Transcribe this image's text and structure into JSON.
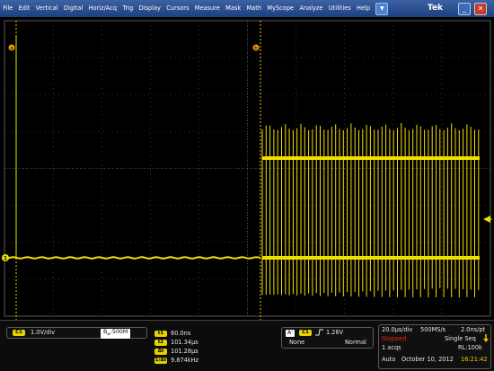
{
  "menu": {
    "items": [
      "File",
      "Edit",
      "Vertical",
      "Digital",
      "Horiz/Acq",
      "Trig",
      "Display",
      "Cursors",
      "Measure",
      "Mask",
      "Math",
      "MyScope",
      "Analyze",
      "Utilities",
      "Help"
    ],
    "dropdown_icon": "triangle-down-icon",
    "brand": "Tek",
    "minimize_glyph": "_",
    "close_glyph": "✕"
  },
  "display": {
    "trace_color": "#f0e000",
    "grid_color": "#5a5a5a",
    "cursor_a_label": "a",
    "cursor_b_label": "b",
    "channel_marker": "1"
  },
  "channel": {
    "badge": "C1",
    "scale": "1.0V/div",
    "bandwidth_prefix": "B",
    "bandwidth_sub": "w",
    "bandwidth": ":500M"
  },
  "cursors": {
    "t1_label": "t1",
    "t1": "60.0ns",
    "t2_label": "t2",
    "t2": "101.34μs",
    "dt_label": "Δt",
    "dt": "101.28μs",
    "inv_label": "1/Δt",
    "inv": "9.874kHz"
  },
  "trigger": {
    "mode_badge": "A'",
    "source_badge": "C1",
    "slope_icon": "rising-edge-icon",
    "level": "1.26V",
    "coupling": "None",
    "type": "Normal"
  },
  "timebase": {
    "scale": "20.0μs/div",
    "sample_rate": "500MS/s",
    "resolution": "2.0ns/pt",
    "state": "Stopped",
    "sequence": "Single Seq",
    "acqs": "1 acqs",
    "record_length": "RL:100k",
    "mode": "Auto",
    "date": "October 10, 2012",
    "time": "16:21:42"
  }
}
